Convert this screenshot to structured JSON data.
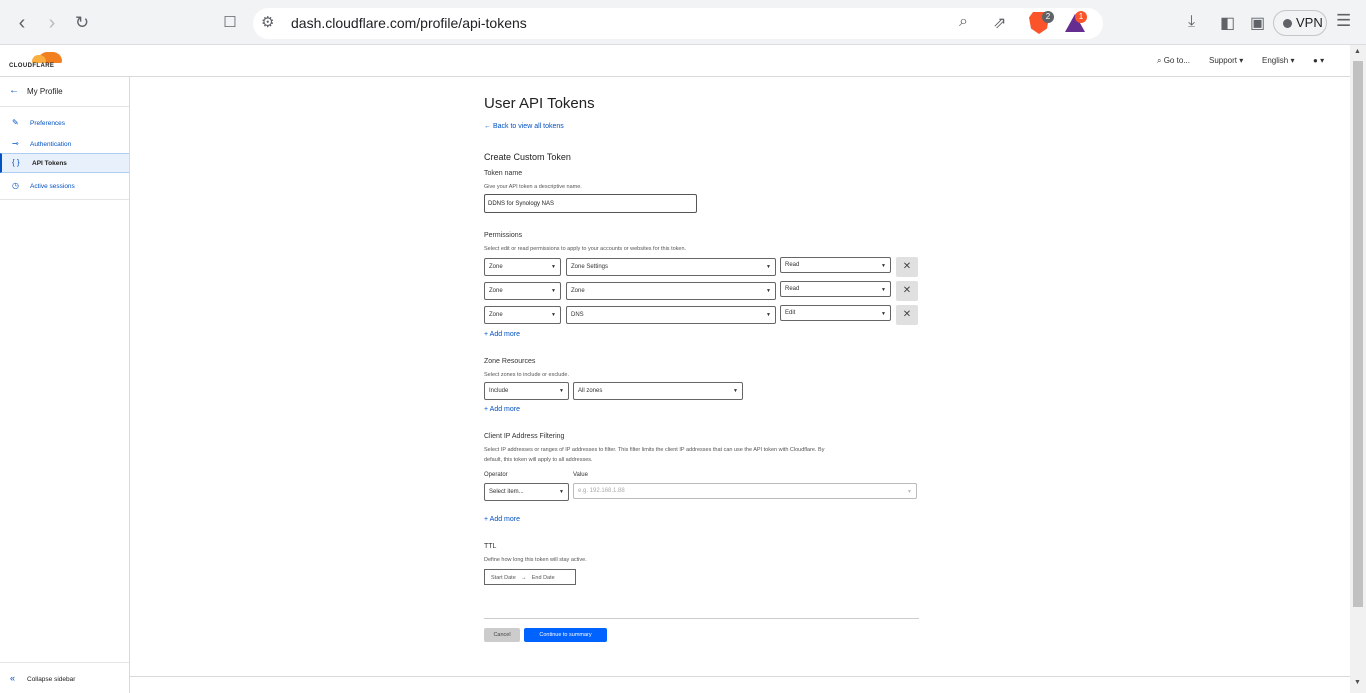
{
  "browser": {
    "url": "dash.cloudflare.com/profile/api-tokens",
    "brave_badge": "2",
    "rewards_badge": "1",
    "vpn_label": "VPN"
  },
  "header": {
    "logo_text": "CLOUDFLARE",
    "goto": "Go to...",
    "support": "Support",
    "language": "English"
  },
  "sidebar": {
    "back_label": "My Profile",
    "items": [
      {
        "label": "Preferences",
        "icon": "pencil-icon"
      },
      {
        "label": "Authentication",
        "icon": "key-icon"
      },
      {
        "label": "API Tokens",
        "icon": "braces-icon"
      },
      {
        "label": "Active sessions",
        "icon": "clock-icon"
      }
    ],
    "collapse_label": "Collapse sidebar"
  },
  "main": {
    "title": "User API Tokens",
    "back_link": "Back to view all tokens",
    "section_title": "Create Custom Token",
    "token_name": {
      "label": "Token name",
      "hint": "Give your API token a descriptive name.",
      "value": "DDNS for Synology NAS"
    },
    "permissions": {
      "label": "Permissions",
      "hint": "Select edit or read permissions to apply to your accounts or websites for this token.",
      "rows": [
        {
          "scope": "Zone",
          "resource": "Zone Settings",
          "access": "Read"
        },
        {
          "scope": "Zone",
          "resource": "Zone",
          "access": "Read"
        },
        {
          "scope": "Zone",
          "resource": "DNS",
          "access": "Edit"
        }
      ],
      "add_more": "+ Add more"
    },
    "zone_resources": {
      "label": "Zone Resources",
      "hint": "Select zones to include or exclude.",
      "include": "Include",
      "zones": "All zones",
      "add_more": "+ Add more"
    },
    "ip_filter": {
      "label": "Client IP Address Filtering",
      "hint1": "Select IP addresses or ranges of IP addresses to filter. This filter limits the client IP addresses that can use the API token with Cloudflare. By",
      "hint2": "default, this token will apply to all addresses.",
      "operator_label": "Operator",
      "value_label": "Value",
      "operator_placeholder": "Select item...",
      "value_placeholder": "e.g. 192.168.1.88",
      "add_more": "+ Add more"
    },
    "ttl": {
      "label": "TTL",
      "hint": "Define how long this token will stay active.",
      "start": "Start Date",
      "end": "End Date"
    },
    "cancel": "Cancel",
    "continue": "Continue to summary"
  }
}
